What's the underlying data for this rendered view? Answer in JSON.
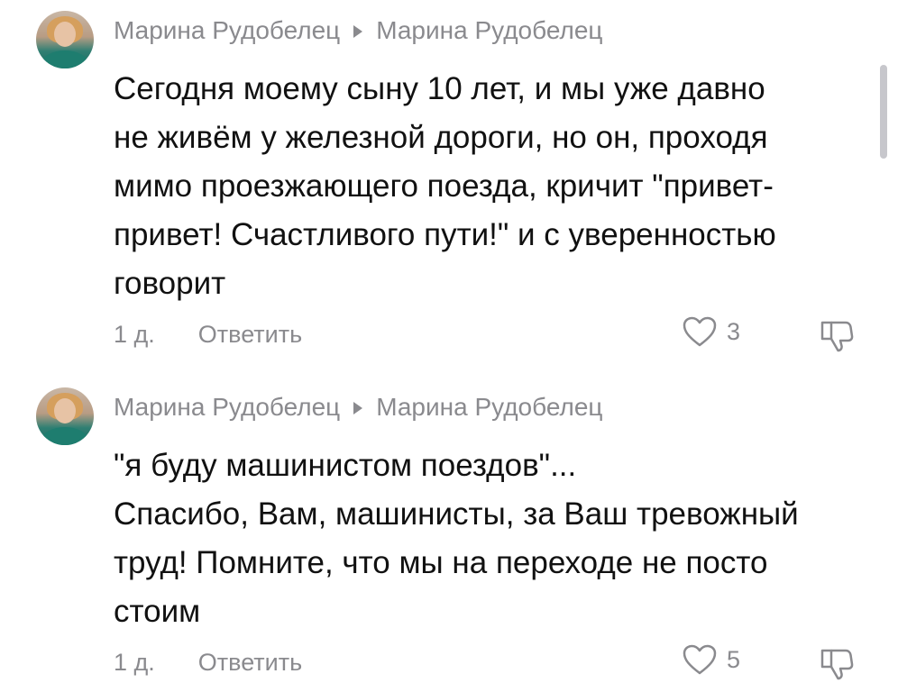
{
  "comments": [
    {
      "author": "Марина Рудобелец",
      "reply_to": "Марина Рудобелец",
      "text_lines": [
        "Сегодня моему сыну 10 лет, и мы уже давно",
        "не живём у железной дороги, но он, проходя",
        "мимо проезжающего поезда, кричит \"привет-",
        "привет! Счастливого пути!\" и с уверенностью",
        "говорит"
      ],
      "time": "1 д.",
      "reply_label": "Ответить",
      "likes": "3"
    },
    {
      "author": "Марина Рудобелец",
      "reply_to": "Марина Рудобелец",
      "text_lines": [
        "\"я буду машинистом поездов\"...",
        "Спасибо, Вам, машинисты, за Ваш тревожный",
        "труд! Помните, что мы на переходе не посто",
        "стоим"
      ],
      "time": "1 д.",
      "reply_label": "Ответить",
      "likes": "5"
    }
  ],
  "icons": {
    "reply_arrow": "caret-right-icon",
    "like": "heart-outline-icon",
    "dislike": "thumbs-down-outline-icon"
  },
  "colors": {
    "text": "#111111",
    "secondary": "#8a8a8e",
    "scrollbar": "#c7c7cc"
  }
}
